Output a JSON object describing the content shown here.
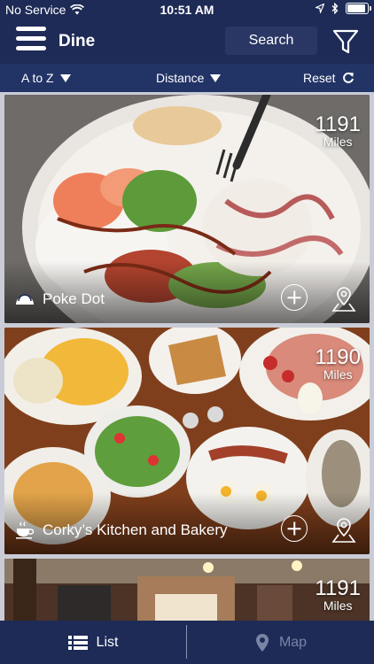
{
  "status_bar": {
    "carrier": "No Service",
    "time": "10:51 AM",
    "battery_fraction": 1.0
  },
  "nav": {
    "title": "Dine",
    "search_label": "Search"
  },
  "sort": {
    "alpha_label": "A to Z",
    "distance_label": "Distance",
    "reset_label": "Reset"
  },
  "restaurants": [
    {
      "name": "Poke Dot",
      "distance": "1191",
      "unit": "Miles",
      "category_icon": "taco-icon"
    },
    {
      "name": "Corky’s Kitchen and Bakery",
      "distance": "1190",
      "unit": "Miles",
      "category_icon": "coffee-cup-icon"
    },
    {
      "name": "",
      "distance": "1191",
      "unit": "Miles",
      "category_icon": ""
    }
  ],
  "tabs": {
    "list_label": "List",
    "map_label": "Map"
  },
  "colors": {
    "nav_bg": "#1e2b57",
    "sort_bg": "#223366",
    "accent": "#ffffff"
  }
}
